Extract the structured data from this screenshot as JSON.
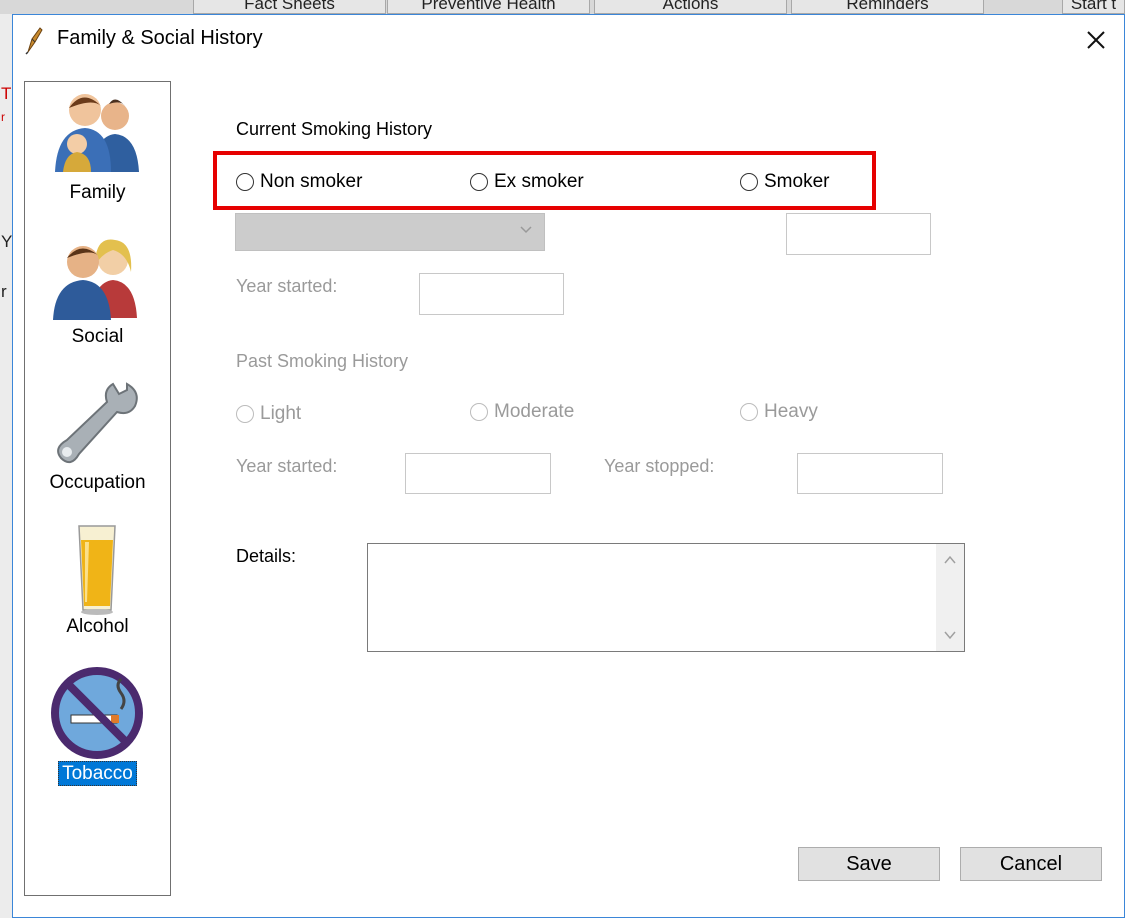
{
  "background": {
    "tabs": [
      "Fact Sheets",
      "Preventive Health",
      "Actions",
      "Reminders",
      "Start t"
    ],
    "fragments": [
      "T",
      "r",
      "Y",
      "r"
    ]
  },
  "dialog": {
    "title": "Family & Social History",
    "close_glyph": "✕"
  },
  "sidebar": {
    "items": [
      {
        "label": "Family",
        "icon": "family-icon"
      },
      {
        "label": "Social",
        "icon": "social-icon"
      },
      {
        "label": "Occupation",
        "icon": "wrench-icon"
      },
      {
        "label": "Alcohol",
        "icon": "beer-icon"
      },
      {
        "label": "Tobacco",
        "icon": "no-smoking-icon",
        "selected": true
      }
    ]
  },
  "current_smoking": {
    "heading": "Current Smoking History",
    "options": [
      "Non smoker",
      "Ex smoker",
      "Smoker"
    ],
    "selected": null,
    "amount_select_value": "",
    "amount_field_value": "",
    "year_started_label": "Year started:",
    "year_started_value": ""
  },
  "past_smoking": {
    "heading": "Past Smoking History",
    "options": [
      "Light",
      "Moderate",
      "Heavy"
    ],
    "year_started_label": "Year started:",
    "year_started_value": "",
    "year_stopped_label": "Year stopped:",
    "year_stopped_value": ""
  },
  "details": {
    "label": "Details:",
    "value": ""
  },
  "buttons": {
    "save": "Save",
    "cancel": "Cancel"
  },
  "colors": {
    "highlight": "#e60000",
    "selection": "#0078d7",
    "window_border": "#3b86d8",
    "disabled_text": "#9a9a9a"
  }
}
